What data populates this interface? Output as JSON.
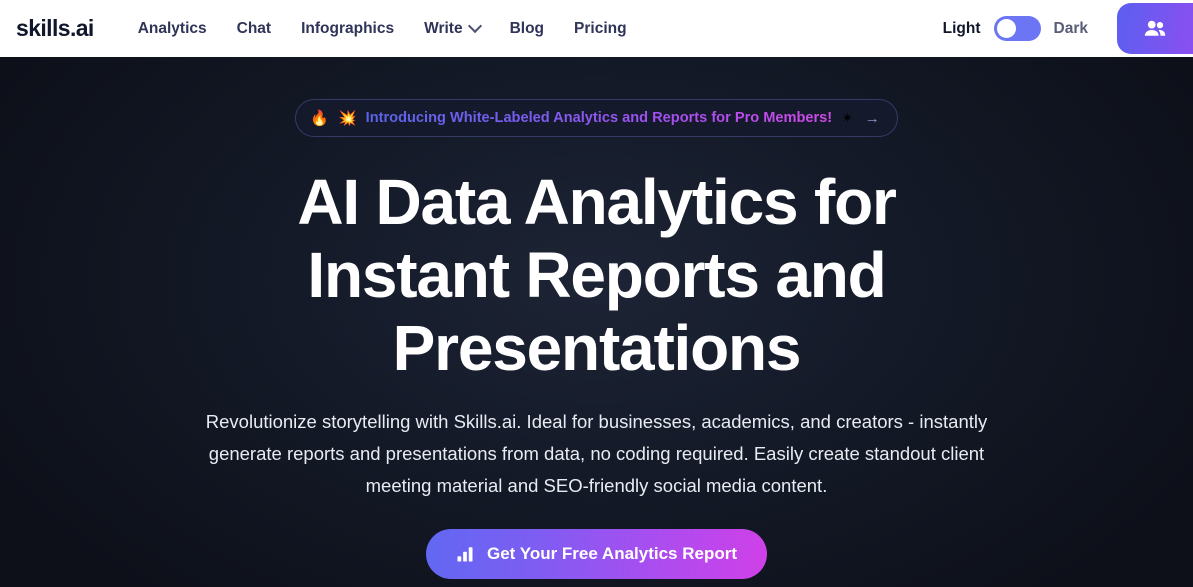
{
  "header": {
    "logo": "skills.ai",
    "nav": [
      {
        "label": "Analytics",
        "has_dropdown": false
      },
      {
        "label": "Chat",
        "has_dropdown": false
      },
      {
        "label": "Infographics",
        "has_dropdown": false
      },
      {
        "label": "Write",
        "has_dropdown": true
      },
      {
        "label": "Blog",
        "has_dropdown": false
      },
      {
        "label": "Pricing",
        "has_dropdown": false
      }
    ],
    "theme_toggle": {
      "light_label": "Light",
      "dark_label": "Dark",
      "state": "light",
      "track_color": "#6c75f3",
      "knob_color": "#ffffff"
    },
    "users_button": {
      "icon": "users-icon",
      "gradient_start": "#5b5ff0",
      "gradient_end": "#8b4ff0"
    },
    "background_color": "#ffffff",
    "nav_text_color": "#2f3458"
  },
  "hero": {
    "background_color": "#0d1019",
    "banner": {
      "fire_emoji": "🔥",
      "sparkle_left": "💥",
      "text": "Introducing White-Labeled Analytics and Reports for Pro Members!",
      "sparkle_right": "✴",
      "arrow": "→",
      "gradient_start": "#5b63e8",
      "gradient_end": "#d04ae8",
      "border_color": "#343b66"
    },
    "headline": "AI Data Analytics for Instant Reports and Presentations",
    "subhead": "Revolutionize storytelling with Skills.ai. Ideal for businesses, academics, and creators - instantly generate reports and presentations from data, no coding required. Easily create standout client meeting material and SEO-friendly social media content.",
    "cta": {
      "label": "Get Your Free Analytics Report",
      "icon": "bar-chart-icon",
      "gradient_start": "#6168f2",
      "gradient_end": "#d040e8",
      "text_color": "#ffffff"
    }
  }
}
